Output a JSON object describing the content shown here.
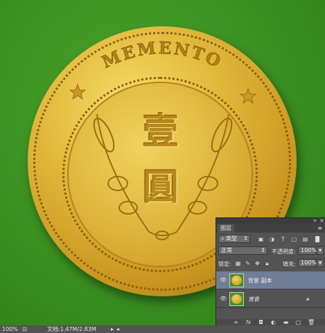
{
  "canvas": {
    "coin_legend": "MEMENTO",
    "coin_characters": [
      "壹",
      "圓"
    ]
  },
  "status": {
    "zoom": "100%",
    "doc_info": "文档:1.47M/2.83M"
  },
  "layers_panel": {
    "tab_label": "图层",
    "filter_kind": "类型",
    "blend_mode": "正常",
    "opacity_label": "不透明度:",
    "opacity_value": "100%",
    "lock_label": "锁定:",
    "fill_label": "填充:",
    "fill_value": "100%",
    "layers": [
      {
        "name": "背景 副本",
        "selected": true,
        "locked": false
      },
      {
        "name": "背景",
        "selected": false,
        "locked": true
      }
    ],
    "bottom_icons": [
      "link-icon",
      "fx-icon",
      "mask-icon",
      "adjustment-icon",
      "folder-icon",
      "new-layer-icon",
      "trash-icon"
    ]
  },
  "colors": {
    "panel_bg": "#535353",
    "selected_layer": "#6f7d95",
    "background_green": "#3d9322",
    "gold": "#e2b93b"
  }
}
